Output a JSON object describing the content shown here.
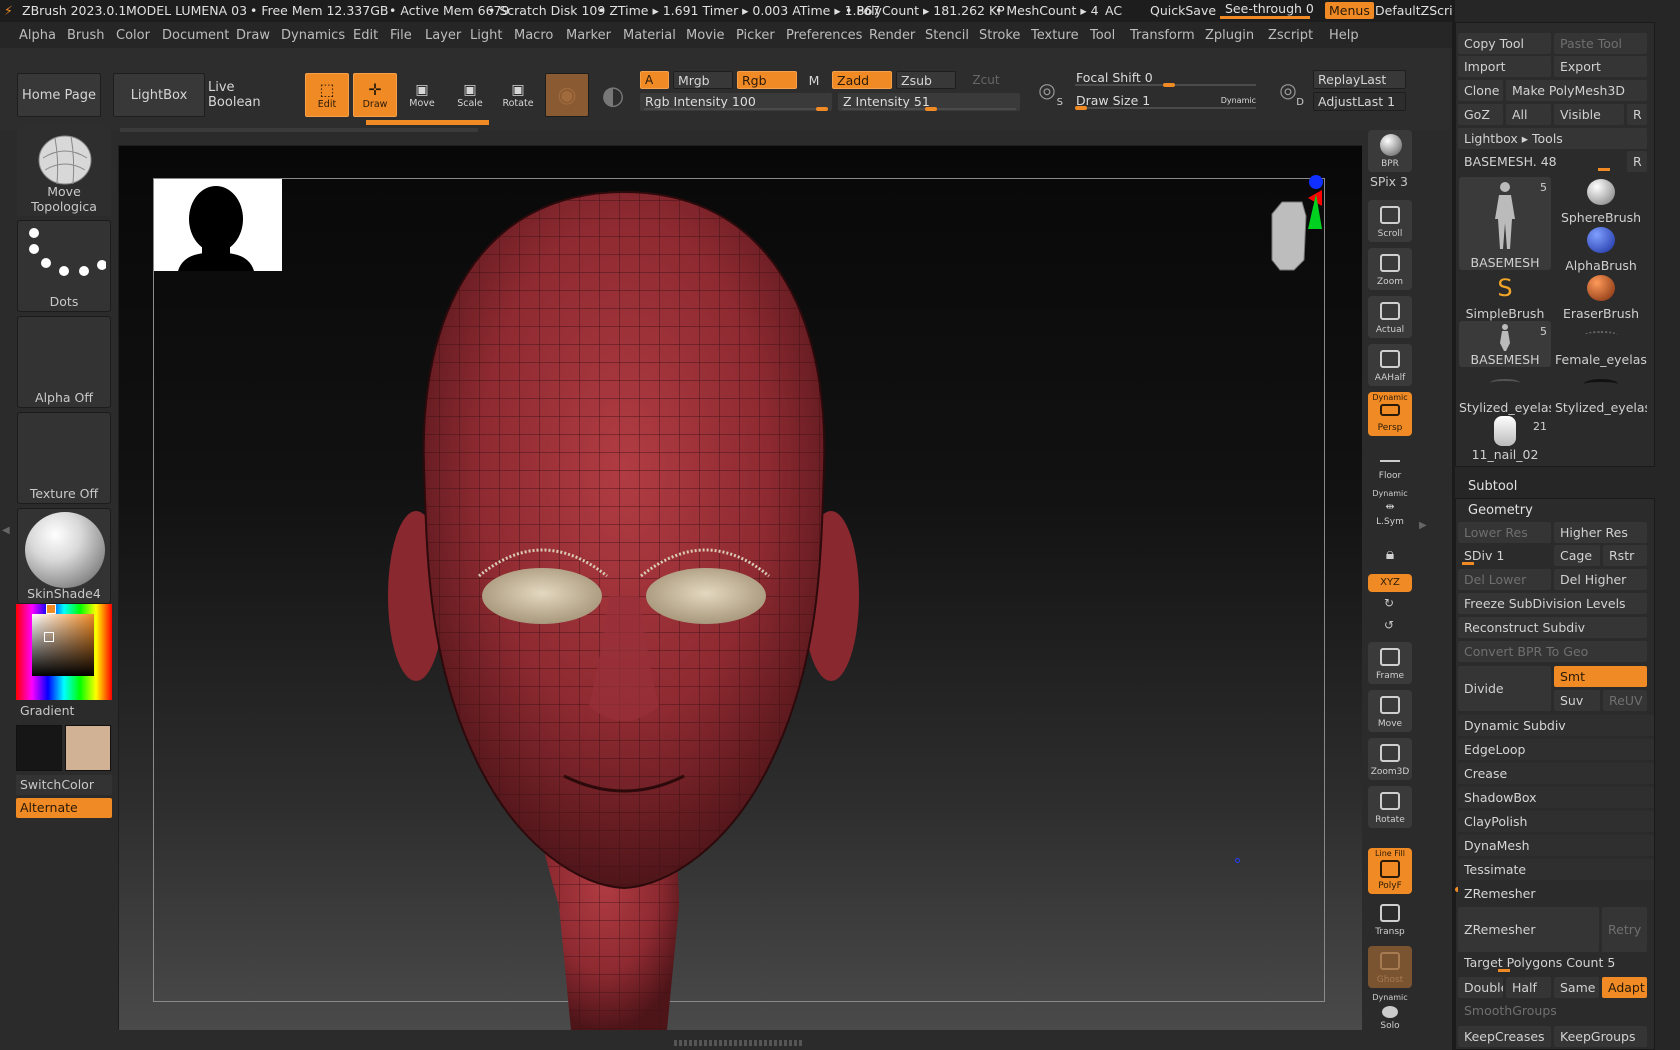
{
  "title": {
    "app": "ZBrush 2023.0.1",
    "doc": "MODEL LUMENA 03",
    "free_mem": "• Free Mem 12.337GB",
    "active_mem": "• Active Mem 6679",
    "scratch": "• Scratch Disk 109",
    "ztime": "• ZTime ▸ 1.691 Timer ▸ 0.003 ATime ▸ 1.867",
    "polycount": "• PolyCount ▸ 181.262 KP",
    "meshcount": "• MeshCount ▸ 4",
    "ac": "AC",
    "quicksave": "QuickSave",
    "seethrough": "See-through  0",
    "menus": "Menus",
    "zscript": "DefaultZScript"
  },
  "menu": [
    "Alpha",
    "Brush",
    "Color",
    "Document",
    "Draw",
    "Dynamics",
    "Edit",
    "File",
    "Layer",
    "Light",
    "Macro",
    "Marker",
    "Material",
    "Movie",
    "Picker",
    "Preferences",
    "Render",
    "Stencil",
    "Stroke",
    "Texture",
    "Tool",
    "Transform",
    "Zplugin",
    "Zscript",
    "Help"
  ],
  "toolbar": {
    "home": "Home Page",
    "lightbox": "LightBox",
    "liveboolean": "Live Boolean",
    "edit": "Edit",
    "draw": "Draw",
    "move": "Move",
    "scale": "Scale",
    "rotate": "Rotate",
    "a": "A",
    "mrgb": "Mrgb",
    "rgb": "Rgb",
    "m": "M",
    "zadd": "Zadd",
    "zsub": "Zsub",
    "zcut": "Zcut",
    "rgb_intensity": "Rgb Intensity 100",
    "z_intensity": "Z Intensity 51",
    "focal_shift": "Focal Shift 0",
    "draw_size": "Draw Size 1",
    "dynamic": "Dynamic",
    "replay": "ReplayLast",
    "adjust": "AdjustLast 1",
    "s": "S",
    "d": "D",
    "rgb_intensity_val": 1.0,
    "z_intensity_val": 0.51
  },
  "left": {
    "brush": "Move Topologica",
    "stroke": "Dots",
    "alpha": "Alpha Off",
    "texture": "Texture Off",
    "material": "SkinShade4",
    "gradient": "Gradient",
    "switch": "SwitchColor",
    "alternate": "Alternate"
  },
  "nav": {
    "bpr": "BPR",
    "spix": "SPix 3",
    "scroll": "Scroll",
    "zoom": "Zoom",
    "actual": "Actual",
    "aahalf": "AAHalf",
    "persp_top": "Dynamic",
    "persp": "Persp",
    "floor": "Floor",
    "lsym_top": "Dynamic",
    "lsym": "L.Sym",
    "xyz": "XYZ",
    "frame": "Frame",
    "move": "Move",
    "zoom3d": "Zoom3D",
    "rotate": "Rotate",
    "polyf_top": "Line Fill",
    "polyf": "PolyF",
    "transp": "Transp",
    "ghost": "Ghost",
    "solo_top": "Dynamic",
    "solo": "Solo"
  },
  "tray": {
    "copy": "Copy Tool",
    "paste": "Paste Tool",
    "import": "Import",
    "export": "Export",
    "clone": "Clone",
    "make": "Make PolyMesh3D",
    "goz": "GoZ",
    "all": "All",
    "visible": "Visible",
    "r": "R",
    "lightbox_tools": "Lightbox ▸ Tools",
    "basemesh_slider": "BASEMESH. 48",
    "tools": [
      {
        "name": "BASEMESH",
        "count": "5"
      },
      {
        "name": "SphereBrush",
        "count": ""
      },
      {
        "name": "AlphaBrush",
        "count": ""
      },
      {
        "name": "SimpleBrush",
        "count": ""
      },
      {
        "name": "EraserBrush",
        "count": ""
      },
      {
        "name": "BASEMESH",
        "count": "5"
      },
      {
        "name": "Female_eyelashe",
        "count": ""
      },
      {
        "name": "Stylized_eyelash",
        "count": ""
      },
      {
        "name": "Stylized_eyelash",
        "count": ""
      },
      {
        "name": "11_nail_02",
        "count": "21"
      }
    ],
    "subtool": "Subtool",
    "geometry": "Geometry",
    "lower_res": "Lower Res",
    "higher_res": "Higher Res",
    "sdiv": "SDiv 1",
    "cage": "Cage",
    "rstr": "Rstr",
    "del_lower": "Del Lower",
    "del_higher": "Del Higher",
    "freeze": "Freeze SubDivision Levels",
    "reconstruct": "Reconstruct Subdiv",
    "convert_bpr": "Convert BPR To Geo",
    "divide": "Divide",
    "smt": "Smt",
    "suv": "Suv",
    "reuv": "ReUV",
    "sections": [
      "Dynamic Subdiv",
      "EdgeLoop",
      "Crease",
      "ShadowBox",
      "ClayPolish",
      "DynaMesh",
      "Tessimate"
    ],
    "zremesher_section": "ZRemesher",
    "zremesher_btn": "ZRemesher",
    "retry": "Retry",
    "target": "Target Polygons Count 5",
    "double": "Double",
    "half": "Half",
    "same": "Same",
    "adapt": "Adapt",
    "smoothgroups": "SmoothGroups",
    "keepcreases": "KeepCreases",
    "keepgroups": "KeepGroups"
  },
  "colors": {
    "accent": "#f08a24",
    "mesh": "#9c2f35",
    "bg": "#2b2b2b"
  }
}
